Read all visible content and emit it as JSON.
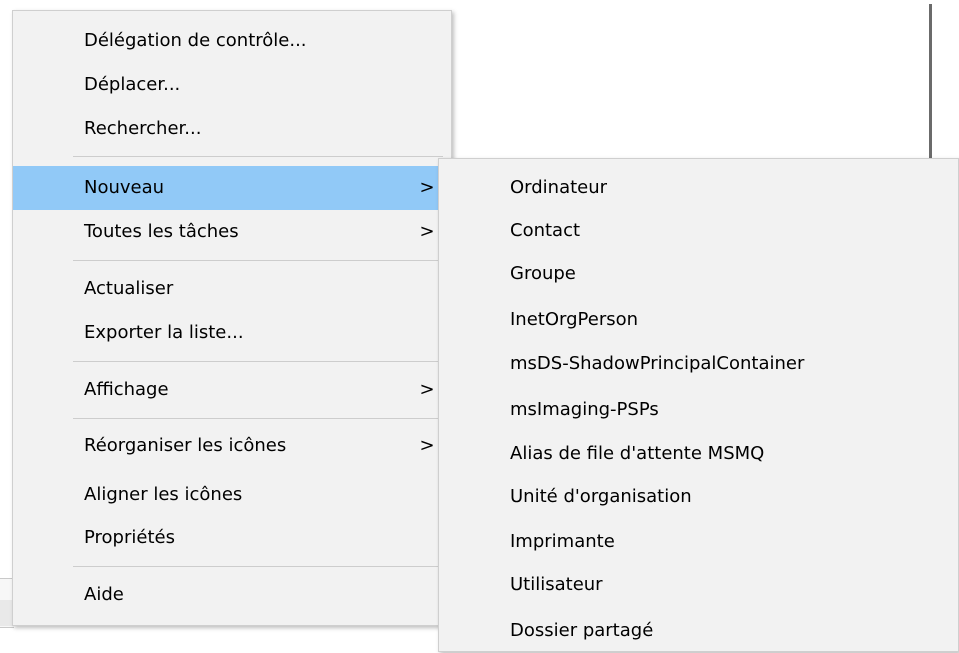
{
  "main_menu": {
    "items": [
      {
        "label": "Délégation de contrôle..."
      },
      {
        "label": "Déplacer..."
      },
      {
        "label": "Rechercher..."
      },
      {
        "label": "Nouveau",
        "submenu": true,
        "highlighted": true
      },
      {
        "label": "Toutes les tâches",
        "submenu": true
      },
      {
        "label": "Actualiser"
      },
      {
        "label": "Exporter la liste..."
      },
      {
        "label": "Affichage",
        "submenu": true
      },
      {
        "label": "Réorganiser les icônes",
        "submenu": true
      },
      {
        "label": "Aligner les icônes"
      },
      {
        "label": "Propriétés"
      },
      {
        "label": "Aide"
      }
    ],
    "submenu_arrow": ">"
  },
  "sub_menu": {
    "items": [
      {
        "label": "Ordinateur"
      },
      {
        "label": "Contact"
      },
      {
        "label": "Groupe"
      },
      {
        "label": "InetOrgPerson"
      },
      {
        "label": "msDS-ShadowPrincipalContainer"
      },
      {
        "label": "msImaging-PSPs"
      },
      {
        "label": "Alias de file d'attente MSMQ"
      },
      {
        "label": "Unité d'organisation"
      },
      {
        "label": "Imprimante"
      },
      {
        "label": "Utilisateur"
      },
      {
        "label": "Dossier partagé"
      }
    ]
  },
  "colors": {
    "menu_bg": "#f2f2f2",
    "highlight": "#91c9f7",
    "separator": "#cdcdcd"
  }
}
